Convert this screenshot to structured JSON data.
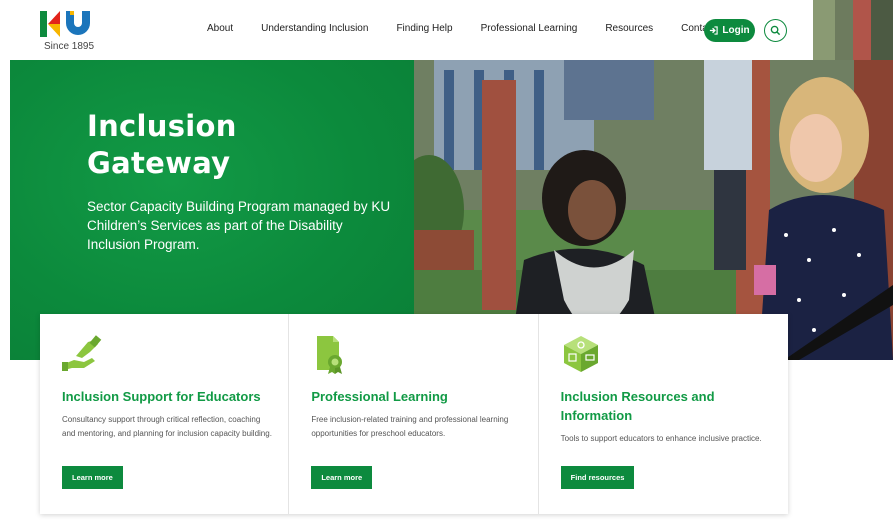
{
  "header": {
    "logo_since": "Since 1895",
    "nav": [
      "About",
      "Understanding Inclusion",
      "Finding Help",
      "Professional Learning",
      "Resources",
      "Contact"
    ],
    "login_label": "Login"
  },
  "hero": {
    "title_line1": "Inclusion",
    "title_line2": "Gateway",
    "subtitle": "Sector Capacity Building Program managed by KU Children’s Services as part of the Disability Inclusion Program."
  },
  "cards": [
    {
      "title": "Inclusion Support for Educators",
      "description": "Consultancy support through critical reflection, coaching and mentoring, and planning for inclusion capacity building.",
      "button": "Learn more",
      "icon": "helping-hands-icon"
    },
    {
      "title": "Professional Learning",
      "description": "Free inclusion-related training and professional learning opportunities for preschool educators.",
      "button": "Learn more",
      "icon": "certificate-icon"
    },
    {
      "title": "Inclusion Resources and Information",
      "description": "Tools to support educators to enhance inclusive practice.",
      "button": "Find resources",
      "icon": "resource-box-icon"
    }
  ],
  "colors": {
    "brand_green": "#0d8a3e",
    "title_green": "#119a45",
    "icon_lime": "#8cc63f",
    "logo_red": "#e2231a",
    "logo_yellow": "#f7b500",
    "logo_blue": "#1b75bb"
  }
}
